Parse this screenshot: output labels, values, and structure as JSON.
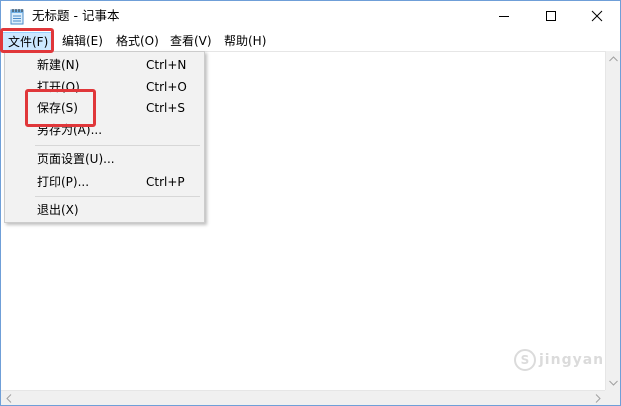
{
  "window": {
    "title": "无标题 - 记事本",
    "controls": {
      "minimize": "minimize",
      "maximize": "maximize",
      "close": "close"
    }
  },
  "menubar": {
    "items": [
      {
        "label": "文件(F)",
        "active": true
      },
      {
        "label": "编辑(E)"
      },
      {
        "label": "格式(O)"
      },
      {
        "label": "查看(V)"
      },
      {
        "label": "帮助(H)"
      }
    ]
  },
  "file_menu": {
    "items": [
      {
        "label": "新建(N)",
        "shortcut": "Ctrl+N"
      },
      {
        "label": "打开(O)...",
        "shortcut": "Ctrl+O"
      },
      {
        "label": "保存(S)",
        "shortcut": "Ctrl+S",
        "highlighted": true
      },
      {
        "label": "另存为(A)...",
        "shortcut": ""
      },
      {
        "label": "页面设置(U)...",
        "shortcut": ""
      },
      {
        "label": "打印(P)...",
        "shortcut": "Ctrl+P"
      },
      {
        "label": "退出(X)",
        "shortcut": ""
      }
    ]
  },
  "editor": {
    "content": ""
  },
  "annotations": {
    "highlight_color": "#e0373a",
    "menu_active_bg": "#cce8ff"
  },
  "watermark": {
    "symbol": "S",
    "text": "jingyan"
  }
}
